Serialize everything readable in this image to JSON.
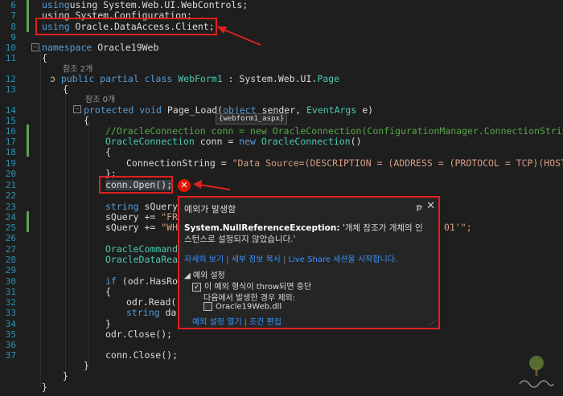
{
  "line_numbers": [
    "6",
    "7",
    "8",
    "9",
    "10",
    "11",
    "12",
    "13",
    "14",
    "15",
    "16",
    "17",
    "18",
    "19",
    "20",
    "21",
    "22",
    "23",
    "24",
    "25",
    "26",
    "27",
    "28",
    "29",
    "30",
    "31",
    "32",
    "33",
    "34",
    "35",
    "36",
    "37"
  ],
  "code": {
    "l6": "using System.Web.UI.WebControls;",
    "l7": "using System.Configuration;",
    "l8_kw": "using",
    "l8_ns": " Oracle.DataAccess.Client;",
    "l10_kw": "namespace",
    "l10_name": " Oracle19Web",
    "l11": "{",
    "ref_class": "참조 2개",
    "l12_kw": "public partial class",
    "l12_name": " WebForm1",
    "l12_rest": " : System.Web.UI.",
    "l12_type": "Page",
    "l13": "{",
    "ref_method": "참조 0개",
    "l14_kw1": "protected void",
    "l14_name": " Page_Load(",
    "l14_kw2": "object",
    "l14_p1": " sender, ",
    "l14_type": "EventArgs",
    "l14_p2": " e)",
    "l15": "{",
    "l16": "//OracleConnection conn = new OracleConnection(ConfigurationManager.ConnectionStrings[",
    "l17_type": "OracleConnection",
    "l17_mid": " conn = ",
    "l17_kw": "new",
    "l17_type2": " OracleConnection",
    "l17_end": "()",
    "l18": "{",
    "l19_a": "ConnectionString = ",
    "l19_str": "\"Data Source=(DESCRIPTION = (ADDRESS = (PROTOCOL = TCP)(HOST =",
    "l20": "};",
    "l21": "conn.Open();",
    "l23_kw": "string",
    "l23_rest": " sQuery",
    "l24_a": "sQuery += ",
    "l24_str": "\"FR",
    "l25_a": "sQuery += ",
    "l25_str": "\"WH",
    "l25_tail": "01'\";",
    "l27": "OracleCommand",
    "l28": "OracleDataRea",
    "l30_kw": "if",
    "l30_rest": " (odr.HasRo",
    "l31": "{",
    "l32": "odr.Read(",
    "l33_kw": "string",
    "l33_rest": " da",
    "l34": "}",
    "l35": "odr.Close();",
    "l37": "conn.Close();",
    "l38": "}",
    "l39": "}",
    "l40": "}"
  },
  "tooltip": "{webform1_aspx}",
  "popup": {
    "title": "예외가 발생함",
    "pin": "ᵽ",
    "close": "✕",
    "exception_type": "System.NullReferenceException:",
    "exception_msg": " '개체 참조가 개체의 인스턴스로 설정되지 않았습니다.'",
    "links": [
      "자세히 보기",
      "세부 정보 복사",
      "Live Share 세션을 시작합니다."
    ],
    "settings_header": "예외 설정",
    "checkbox1": "이 예외 형식이 throw되면 중단",
    "except_label": "다음에서 발생한 경우 제외:",
    "checkbox2": "Oracle19Web.dll",
    "bottom_links": [
      "예외 설정 열기",
      "조건 편집"
    ]
  },
  "error_icon": "x-circle-icon",
  "colors": {
    "keyword": "#569cd6",
    "type": "#4ec9b0",
    "comment": "#57a64a",
    "string": "#d69d85",
    "link": "#3794ff",
    "highlight": "#e02020"
  }
}
